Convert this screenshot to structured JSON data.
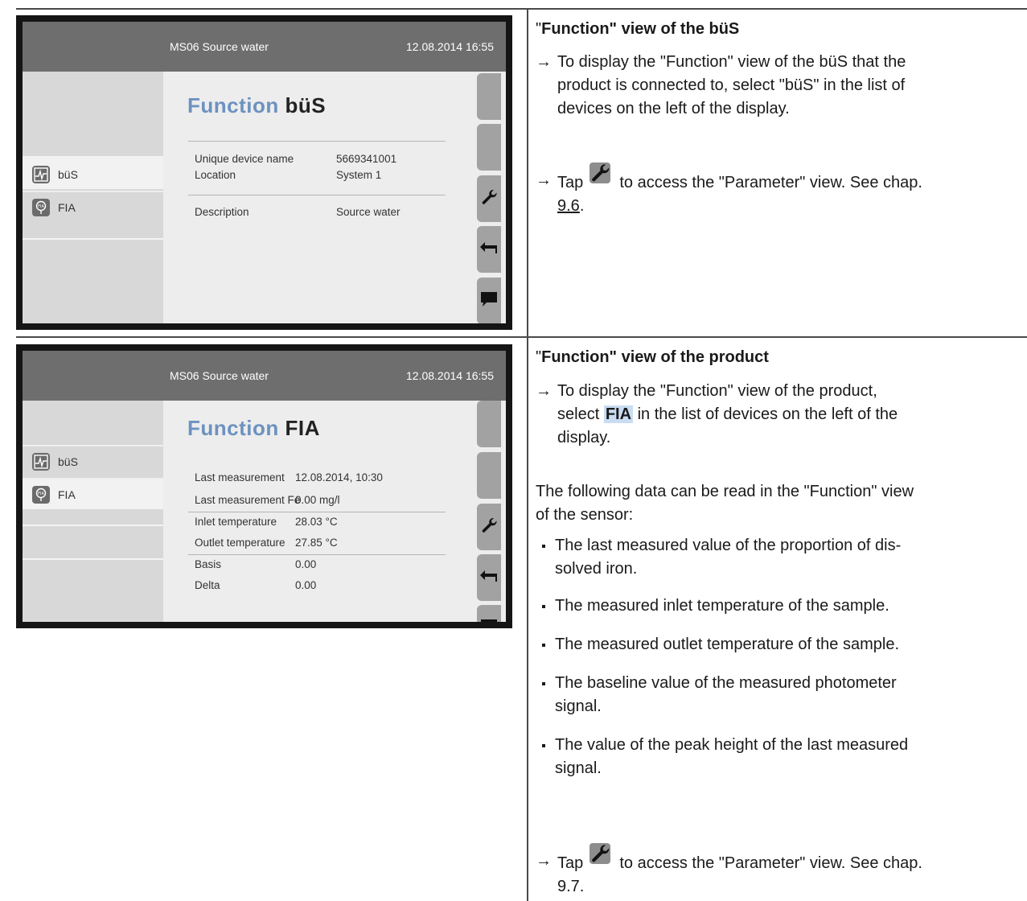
{
  "screen1": {
    "header_name": "MS06 Source water",
    "header_date": "12.08.2014 16:55",
    "title_word": "Function",
    "title_device": "büS",
    "devices": [
      {
        "label": "büS",
        "icon": "bus-device-icon",
        "selected": true
      },
      {
        "label": "FIA",
        "icon": "fia-device-icon",
        "selected": false
      }
    ],
    "rows": [
      {
        "label": "Unique device name",
        "value": "5669341001"
      },
      {
        "label": "Location",
        "value": "System 1"
      },
      {
        "label": "Description",
        "value": "Source water"
      }
    ]
  },
  "screen2": {
    "header_name": "MS06 Source water",
    "header_date": "12.08.2014 16:55",
    "title_word": "Function",
    "title_device": "FIA",
    "devices": [
      {
        "label": "büS",
        "icon": "bus-device-icon",
        "selected": false
      },
      {
        "label": "FIA",
        "icon": "fia-device-icon",
        "selected": true
      }
    ],
    "rows": [
      {
        "label": "Last measurement",
        "value": "12.08.2014, 10:30"
      },
      {
        "label": "Last measurement Fe",
        "value": "0.00 mg/l"
      },
      {
        "label": "Inlet temperature",
        "value": "28.03 °C"
      },
      {
        "label": "Outlet temperature",
        "value": "27.85 °C"
      },
      {
        "label": "Basis",
        "value": "0.00"
      },
      {
        "label": "Delta",
        "value": "0.00"
      }
    ]
  },
  "text1": {
    "heading_q1": "\"",
    "heading_bold": "Function",
    "heading_rest": "\" view of the büS",
    "step1_lines": [
      "To display the \"Function\" view of the büS that the",
      "product is connected to, select \"büS\" in the list of",
      "devices on the left of the display."
    ],
    "step2_pre": "Tap",
    "step2_post": "to access the \"Parameter\" view. See chap.",
    "step2_link": "9.6",
    "step2_end": "."
  },
  "text2": {
    "heading_q1": "\"",
    "heading_bold": "Function",
    "heading_rest": "\" view of the product",
    "step1_line1": "To display the \"Function\" view of the product,",
    "step1_pre": "select",
    "step1_hl": "FIA",
    "step1_post": "in the list of devices on the left of the",
    "step1_line3": "display.",
    "intro_lines": [
      "The following data can be read in the \"Function\" view",
      "of the sensor:"
    ],
    "bullets": [
      [
        "The last measured value of the proportion of dis-",
        "solved iron."
      ],
      [
        "The measured inlet temperature of the sample."
      ],
      [
        "The measured outlet temperature of the sample."
      ],
      [
        "The baseline value of the measured photometer",
        "signal."
      ],
      [
        "The value of the peak height of the last measured",
        "signal."
      ]
    ],
    "step2_pre": "Tap",
    "step2_post": "to access the \"Parameter\" view. See chap.",
    "step2_ref": "9.7."
  },
  "arrow_glyph": "→"
}
